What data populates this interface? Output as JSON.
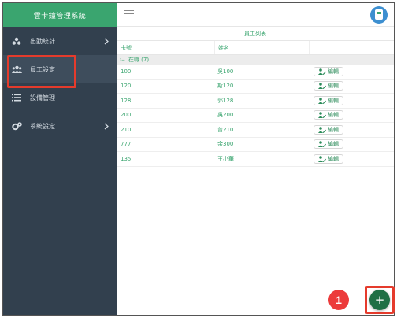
{
  "app": {
    "title": "雲卡鐘管理系統"
  },
  "sidebar": {
    "items": [
      {
        "label": "出勤統計",
        "icon": "group-icon",
        "has_chevron": true
      },
      {
        "label": "員工設定",
        "icon": "users-icon",
        "has_chevron": false,
        "active": true
      },
      {
        "label": "設備管理",
        "icon": "list-icon",
        "has_chevron": false
      },
      {
        "label": "系統設定",
        "icon": "gears-icon",
        "has_chevron": true
      }
    ]
  },
  "table": {
    "title": "員工列表",
    "columns": [
      "卡號",
      "姓名",
      ""
    ],
    "group": {
      "toggle": "⁝−",
      "label": "在職 (7)"
    },
    "edit_label": "編輯",
    "rows": [
      {
        "card": "100",
        "name": "吳100"
      },
      {
        "card": "120",
        "name": "斯120"
      },
      {
        "card": "128",
        "name": "郭128"
      },
      {
        "card": "200",
        "name": "吳200"
      },
      {
        "card": "210",
        "name": "曾210"
      },
      {
        "card": "777",
        "name": "余300"
      },
      {
        "card": "135",
        "name": "王小華"
      }
    ]
  },
  "fab": {
    "label": "+"
  },
  "annotation": {
    "step": "1"
  },
  "colors": {
    "accent": "#3aa56f",
    "sidebar": "#32404e",
    "highlight": "#e53b2c",
    "fab": "#1f6f45"
  }
}
